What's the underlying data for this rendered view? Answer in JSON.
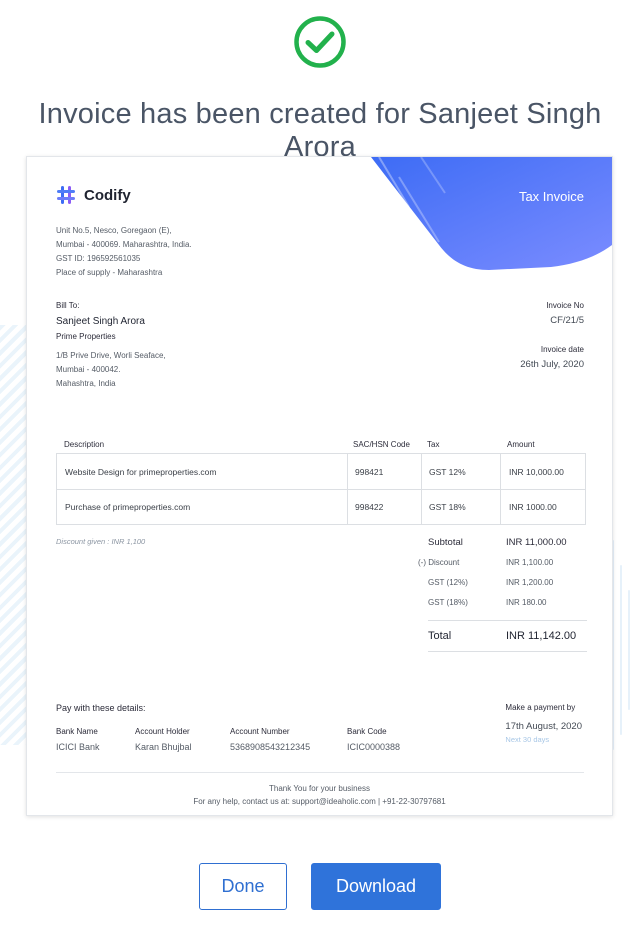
{
  "headline": "Invoice has been created for Sanjeet Singh Arora",
  "icons": {
    "success": "check-circle-icon",
    "logo": "hash-logo-icon"
  },
  "colors": {
    "success": "#22b14c",
    "accent": "#2f73da",
    "corner_from": "#3d6cf5",
    "corner_to": "#7b8cff"
  },
  "invoice": {
    "doc_type": "Tax Invoice",
    "company": {
      "name": "Codify",
      "address_line1": "Unit No.5, Nesco, Goregaon (E),",
      "address_line2": "Mumbai - 400069. Maharashtra, India.",
      "gst": "GST ID: 196592561035",
      "place_of_supply": "Place of supply - Maharashtra"
    },
    "bill_to": {
      "label": "Bill To:",
      "name": "Sanjeet Singh Arora",
      "company": "Prime Properties",
      "address_line1": "1/B Prive Drive, Worli Seaface,",
      "address_line2": "Mumbai - 400042.",
      "address_line3": "Mahashtra, India"
    },
    "invoice_no_label": "Invoice No",
    "invoice_no": "CF/21/5",
    "invoice_date_label": "Invoice date",
    "invoice_date": "26th July, 2020",
    "columns": [
      "Description",
      "SAC/HSN Code",
      "Tax",
      "Amount"
    ],
    "items": [
      {
        "description": "Website Design for primeproperties.com",
        "code": "998421",
        "tax": "GST 12%",
        "amount": "INR 10,000.00"
      },
      {
        "description": "Purchase of primeproperties.com",
        "code": "998422",
        "tax": "GST 18%",
        "amount": "INR 1000.00"
      }
    ],
    "discount_note": "Discount given : INR 1,100",
    "totals": {
      "subtotal_label": "Subtotal",
      "subtotal": "INR 11,000.00",
      "discount_label": "(-) Discount",
      "discount": "INR 1,100.00",
      "gst12_label": "GST (12%)",
      "gst12": "INR 1,200.00",
      "gst18_label": "GST (18%)",
      "gst18": "INR 180.00",
      "total_label": "Total",
      "total": "INR 11,142.00"
    },
    "payment": {
      "title": "Pay with these details:",
      "bank_name_label": "Bank Name",
      "bank_name": "ICICI Bank",
      "holder_label": "Account Holder",
      "holder": "Karan Bhujbal",
      "account_label": "Account Number",
      "account": "5368908543212345",
      "code_label": "Bank Code",
      "code": "ICIC0000388",
      "make_payment_label": "Make a payment by",
      "due_date": "17th August, 2020",
      "due_hint": "Next 30 days"
    },
    "footer": {
      "thanks": "Thank You for your business",
      "contact": "For any help, contact us at: support@ideaholic.com | +91-22-30797681"
    }
  },
  "buttons": {
    "done": "Done",
    "download": "Download"
  }
}
